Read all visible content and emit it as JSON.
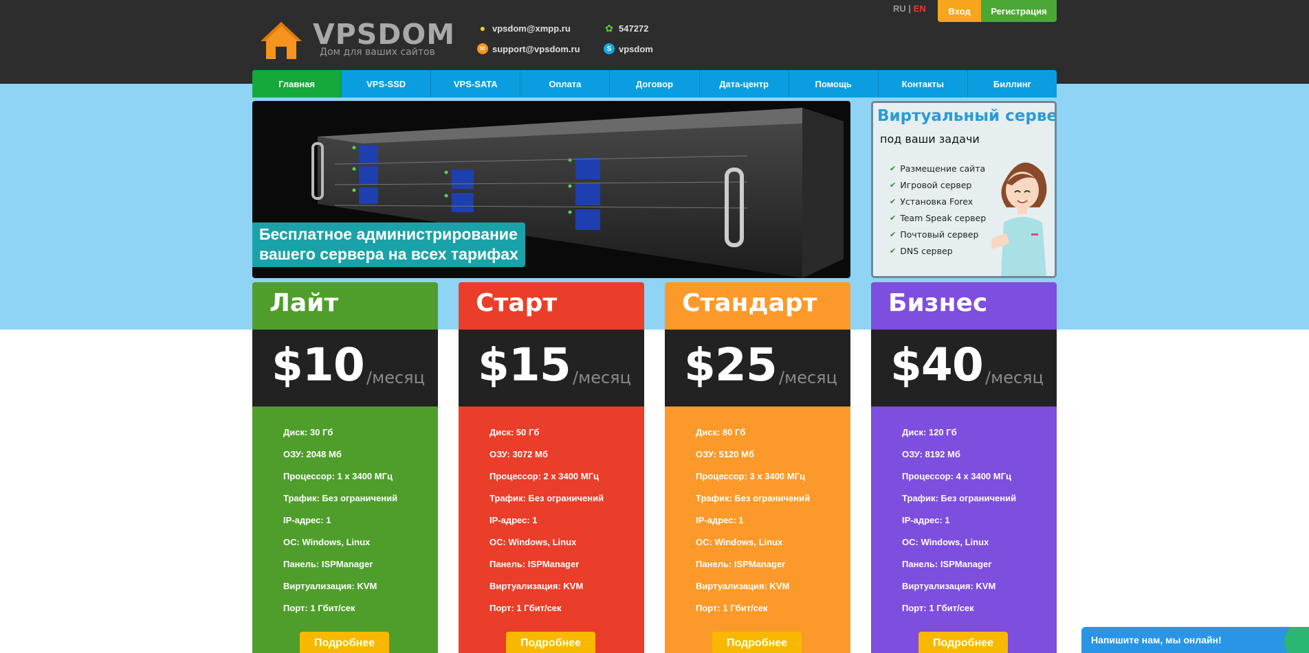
{
  "brand": {
    "name": "VPSDOM",
    "tagline": "Дом для ваших сайтов",
    "accent": "#f7941e"
  },
  "contacts": {
    "xmpp": "vpsdom@xmpp.ru",
    "email": "support@vpsdom.ru",
    "icq": "547272",
    "skype": "vpsdom"
  },
  "lang": {
    "ru": "RU",
    "sep": "|",
    "en": "EN",
    "active": "EN"
  },
  "auth": {
    "login": "Вход",
    "register": "Регистрация"
  },
  "nav": {
    "items": [
      {
        "label": "Главная",
        "active": true
      },
      {
        "label": "VPS-SSD"
      },
      {
        "label": "VPS-SATA"
      },
      {
        "label": "Оплата"
      },
      {
        "label": "Договор"
      },
      {
        "label": "Дата-центр"
      },
      {
        "label": "Помощь"
      },
      {
        "label": "Контакты"
      },
      {
        "label": "Биллинг"
      }
    ]
  },
  "banner": {
    "line1": "Бесплатное администрирование",
    "line2": "вашего сервера на всех тарифах"
  },
  "sidead": {
    "title": "Виртуальный сервер",
    "subtitle": "под ваши задачи",
    "items": [
      "Размещение сайта",
      "Игровой сервер",
      "Установка Forex",
      "Team Speak сервер",
      "Почтовый сервер",
      "DNS сервер"
    ]
  },
  "plans": [
    {
      "name": "Лайт",
      "price": "$10",
      "period": "/месяц",
      "color": "#4f9e2c",
      "features": [
        "Диск: 30 Гб",
        "ОЗУ: 2048 Мб",
        "Процессор: 1 x 3400 МГц",
        "Трафик: Без ограничений",
        "IP-адрес: 1",
        "ОС: Windows, Linux",
        "Панель: ISPManager",
        "Виртуализация: KVM",
        "Порт: 1 Гбит/сек"
      ],
      "button": "Подробнее"
    },
    {
      "name": "Старт",
      "price": "$15",
      "period": "/месяц",
      "color": "#ea3e2a",
      "features": [
        "Диск: 50 Гб",
        "ОЗУ: 3072 Мб",
        "Процессор: 2 x 3400 МГц",
        "Трафик: Без ограничений",
        "IP-адрес: 1",
        "ОС: Windows, Linux",
        "Панель: ISPManager",
        "Виртуализация: KVM",
        "Порт: 1 Гбит/сек"
      ],
      "button": "Подробнее"
    },
    {
      "name": "Стандарт",
      "price": "$25",
      "period": "/месяц",
      "color": "#fb9a2a",
      "features": [
        "Диск: 80 Гб",
        "ОЗУ: 5120 Мб",
        "Процессор: 3 x 3400 МГц",
        "Трафик: Без ограничений",
        "IP-адрес: 1",
        "ОС: Windows, Linux",
        "Панель: ISPManager",
        "Виртуализация: KVM",
        "Порт: 1 Гбит/сек"
      ],
      "button": "Подробнее"
    },
    {
      "name": "Бизнес",
      "price": "$40",
      "period": "/месяц",
      "color": "#7e4ede",
      "features": [
        "Диск: 120 Гб",
        "ОЗУ: 8192 Мб",
        "Процессор: 4 x 3400 МГц",
        "Трафик: Без ограничений",
        "IP-адрес: 1",
        "ОС: Windows, Linux",
        "Панель: ISPManager",
        "Виртуализация: KVM",
        "Порт: 1 Гбит/сек"
      ],
      "button": "Подробнее"
    }
  ],
  "chat": {
    "label": "Напишите нам, мы онлайн!"
  }
}
